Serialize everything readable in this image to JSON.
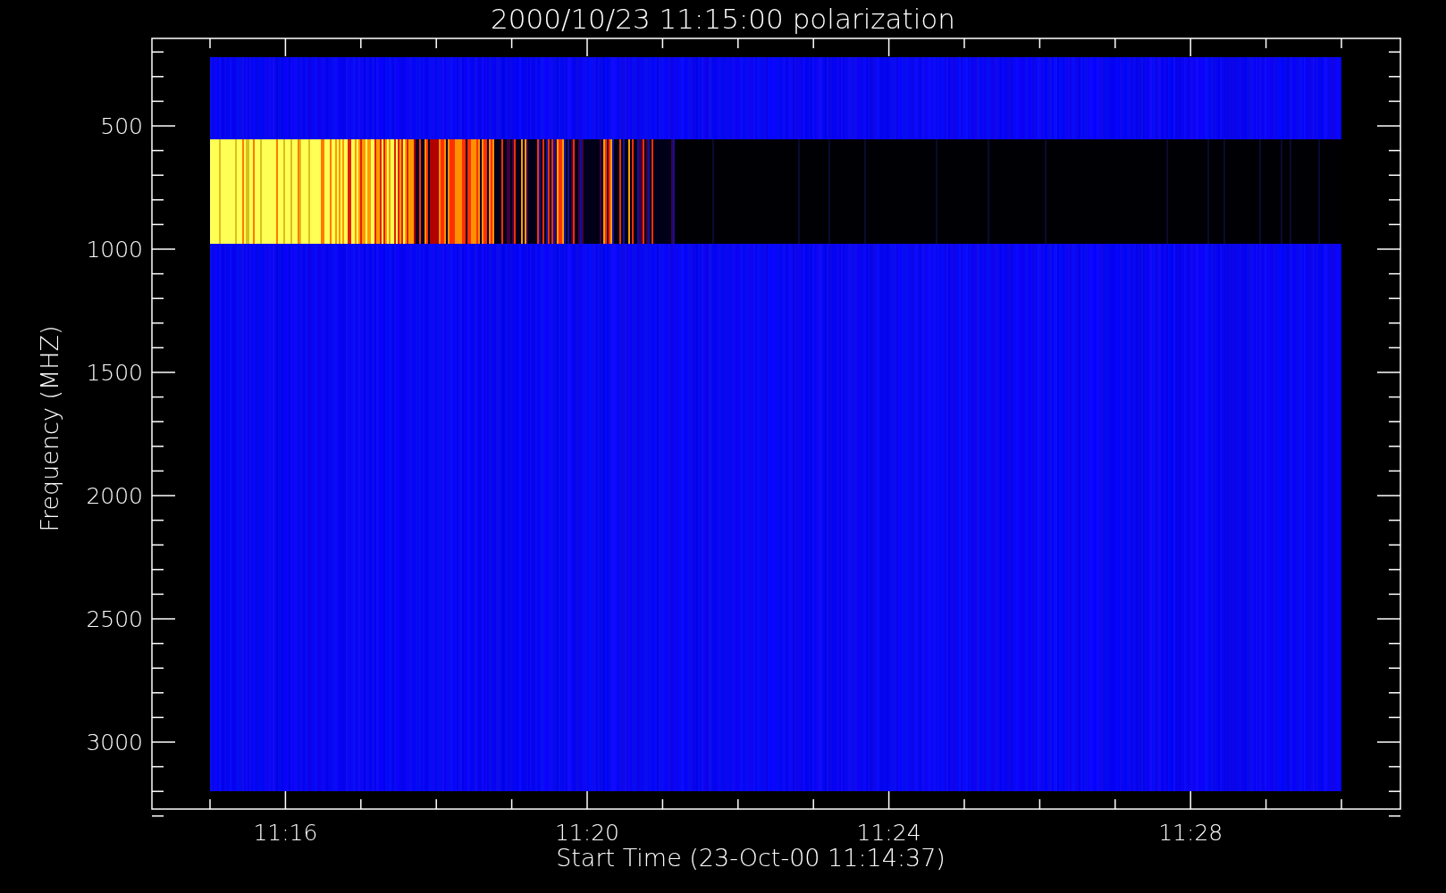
{
  "title": "2000/10/23 11:15:00 polarization",
  "xlabel": "Start Time (23-Oct-00 11:14:37)",
  "ylabel": "Frequency (MHZ)",
  "xticks": [
    "11:16",
    "11:20",
    "11:24",
    "11:28"
  ],
  "yticks": [
    "500",
    "1000",
    "1500",
    "2000",
    "2500",
    "3000"
  ]
}
